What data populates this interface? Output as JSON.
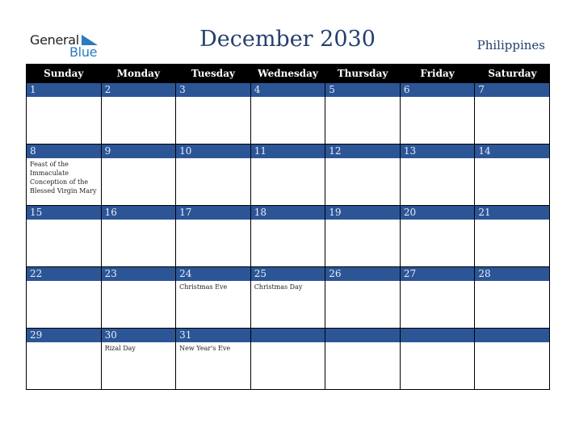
{
  "logo": {
    "line1": "General",
    "line2": "Blue",
    "icon": "triangle-flag-icon"
  },
  "title": "December 2030",
  "country": "Philippines",
  "colors": {
    "header_bg": "#000000",
    "daybar_bg": "#2c5596",
    "title": "#25406e",
    "logo_blue": "#2a7bc0"
  },
  "weekdays": [
    "Sunday",
    "Monday",
    "Tuesday",
    "Wednesday",
    "Thursday",
    "Friday",
    "Saturday"
  ],
  "weeks": [
    [
      {
        "day": "1",
        "event": ""
      },
      {
        "day": "2",
        "event": ""
      },
      {
        "day": "3",
        "event": ""
      },
      {
        "day": "4",
        "event": ""
      },
      {
        "day": "5",
        "event": ""
      },
      {
        "day": "6",
        "event": ""
      },
      {
        "day": "7",
        "event": ""
      }
    ],
    [
      {
        "day": "8",
        "event": "Feast of the Immaculate Conception of the Blessed Virgin Mary"
      },
      {
        "day": "9",
        "event": ""
      },
      {
        "day": "10",
        "event": ""
      },
      {
        "day": "11",
        "event": ""
      },
      {
        "day": "12",
        "event": ""
      },
      {
        "day": "13",
        "event": ""
      },
      {
        "day": "14",
        "event": ""
      }
    ],
    [
      {
        "day": "15",
        "event": ""
      },
      {
        "day": "16",
        "event": ""
      },
      {
        "day": "17",
        "event": ""
      },
      {
        "day": "18",
        "event": ""
      },
      {
        "day": "19",
        "event": ""
      },
      {
        "day": "20",
        "event": ""
      },
      {
        "day": "21",
        "event": ""
      }
    ],
    [
      {
        "day": "22",
        "event": ""
      },
      {
        "day": "23",
        "event": ""
      },
      {
        "day": "24",
        "event": "Christmas Eve"
      },
      {
        "day": "25",
        "event": "Christmas Day"
      },
      {
        "day": "26",
        "event": ""
      },
      {
        "day": "27",
        "event": ""
      },
      {
        "day": "28",
        "event": ""
      }
    ],
    [
      {
        "day": "29",
        "event": ""
      },
      {
        "day": "30",
        "event": "Rizal Day"
      },
      {
        "day": "31",
        "event": "New Year's Eve"
      },
      {
        "day": "",
        "event": ""
      },
      {
        "day": "",
        "event": ""
      },
      {
        "day": "",
        "event": ""
      },
      {
        "day": "",
        "event": ""
      }
    ]
  ]
}
